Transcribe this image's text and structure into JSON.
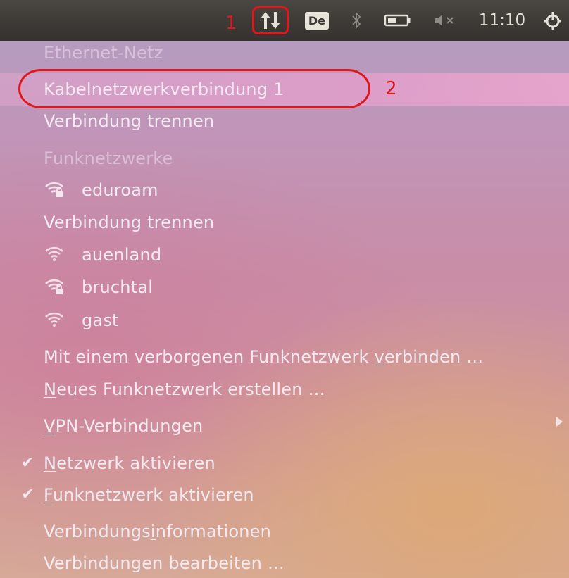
{
  "panel": {
    "network_icon": "network-updown-icon",
    "keyboard_layout": "De",
    "bluetooth_icon": "bluetooth-icon",
    "battery_icon": "battery-icon",
    "sound_icon": "sound-muted-icon",
    "clock": "11:10",
    "system_icon": "power-gear-icon"
  },
  "annotations": {
    "label_1": "1",
    "label_2": "2",
    "color": "#e0181e"
  },
  "menu": {
    "ethernet_header": "Ethernet-Netz",
    "wired_connection": "Kabelnetzwerkverbindung 1",
    "wired_disconnect": "Verbindung trennen",
    "wifi_header": "Funknetzwerke",
    "networks": [
      {
        "name": "eduroam",
        "secured": true,
        "connected": true
      },
      {
        "name": "auenland",
        "secured": false,
        "connected": false
      },
      {
        "name": "bruchtal",
        "secured": true,
        "connected": false
      },
      {
        "name": "gast",
        "secured": false,
        "connected": false
      }
    ],
    "wifi_disconnect": "Verbindung trennen",
    "hidden_network": {
      "pre": "Mit einem verborgenen Funknetzwerk ",
      "u": "v",
      "post": "erbinden …"
    },
    "new_network": {
      "pre": "",
      "u": "N",
      "post": "eues Funknetzwerk erstellen …"
    },
    "vpn": {
      "pre": "",
      "u": "V",
      "post": "PN-Verbindungen"
    },
    "enable_network": {
      "pre": "",
      "u": "N",
      "post": "etzwerk aktivieren",
      "checked": true
    },
    "enable_wifi": {
      "pre": "",
      "u": "F",
      "post": "unknetzwerk aktivieren",
      "checked": true
    },
    "connection_info": {
      "pre": "Verbindungs",
      "u": "i",
      "post": "nformationen"
    },
    "edit_connections": "Verbindungen bearbeiten …",
    "check_glyph": "✔"
  }
}
